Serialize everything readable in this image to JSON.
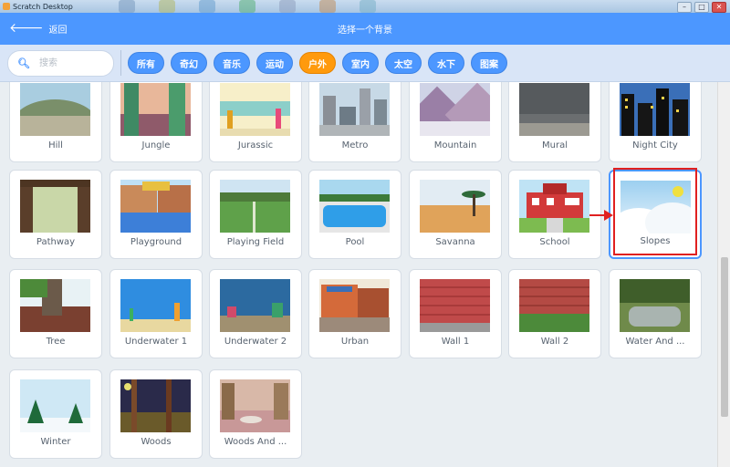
{
  "window": {
    "title": "Scratch Desktop"
  },
  "header": {
    "back_label": "返回",
    "title": "选择一个背景"
  },
  "search": {
    "placeholder": "搜索"
  },
  "tags": [
    "所有",
    "奇幻",
    "音乐",
    "运动",
    "户外",
    "室内",
    "太空",
    "水下",
    "图案"
  ],
  "active_tag": "户外",
  "backdrops": [
    "Hill",
    "Jungle",
    "Jurassic",
    "Metro",
    "Mountain",
    "Mural",
    "Night City",
    "Pathway",
    "Playground",
    "Playing Field",
    "Pool",
    "Savanna",
    "School",
    "Slopes",
    "Tree",
    "Underwater 1",
    "Underwater 2",
    "Urban",
    "Wall 1",
    "Wall 2",
    "Water And ...",
    "Winter",
    "Woods",
    "Woods And ..."
  ],
  "selected_backdrop": "Slopes",
  "colors": {
    "header": "#4c97ff",
    "active_tag": "#ff9a0d",
    "annotation": "#e02020"
  }
}
